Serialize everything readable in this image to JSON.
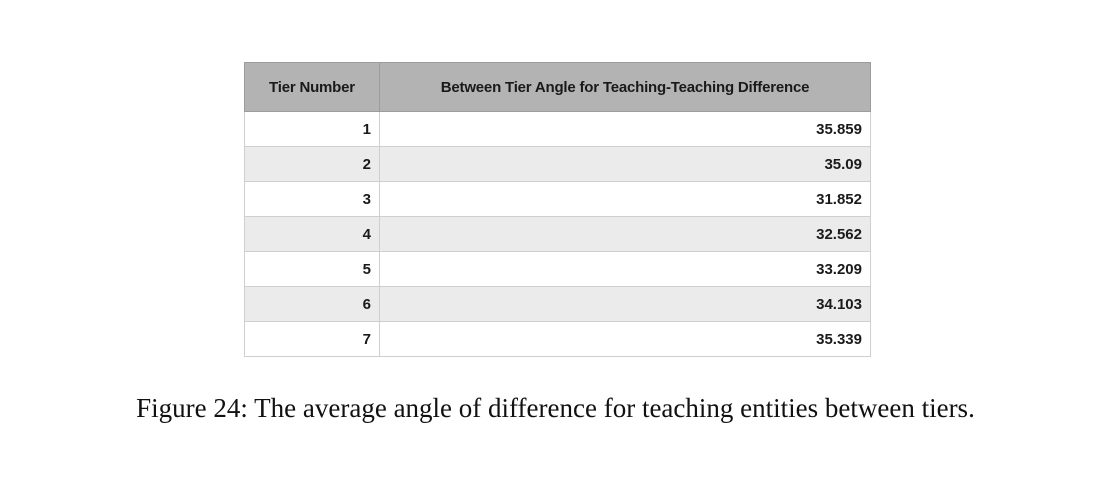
{
  "table": {
    "headers": [
      "Tier Number",
      "Between Tier Angle for Teaching-Teaching Difference"
    ],
    "rows": [
      [
        "1",
        "35.859"
      ],
      [
        "2",
        "35.09"
      ],
      [
        "3",
        "31.852"
      ],
      [
        "4",
        "32.562"
      ],
      [
        "5",
        "33.209"
      ],
      [
        "6",
        "34.103"
      ],
      [
        "7",
        "35.339"
      ]
    ]
  },
  "caption": {
    "label": "Figure 24:",
    "text": "The average angle of difference for teaching entities between tiers."
  }
}
